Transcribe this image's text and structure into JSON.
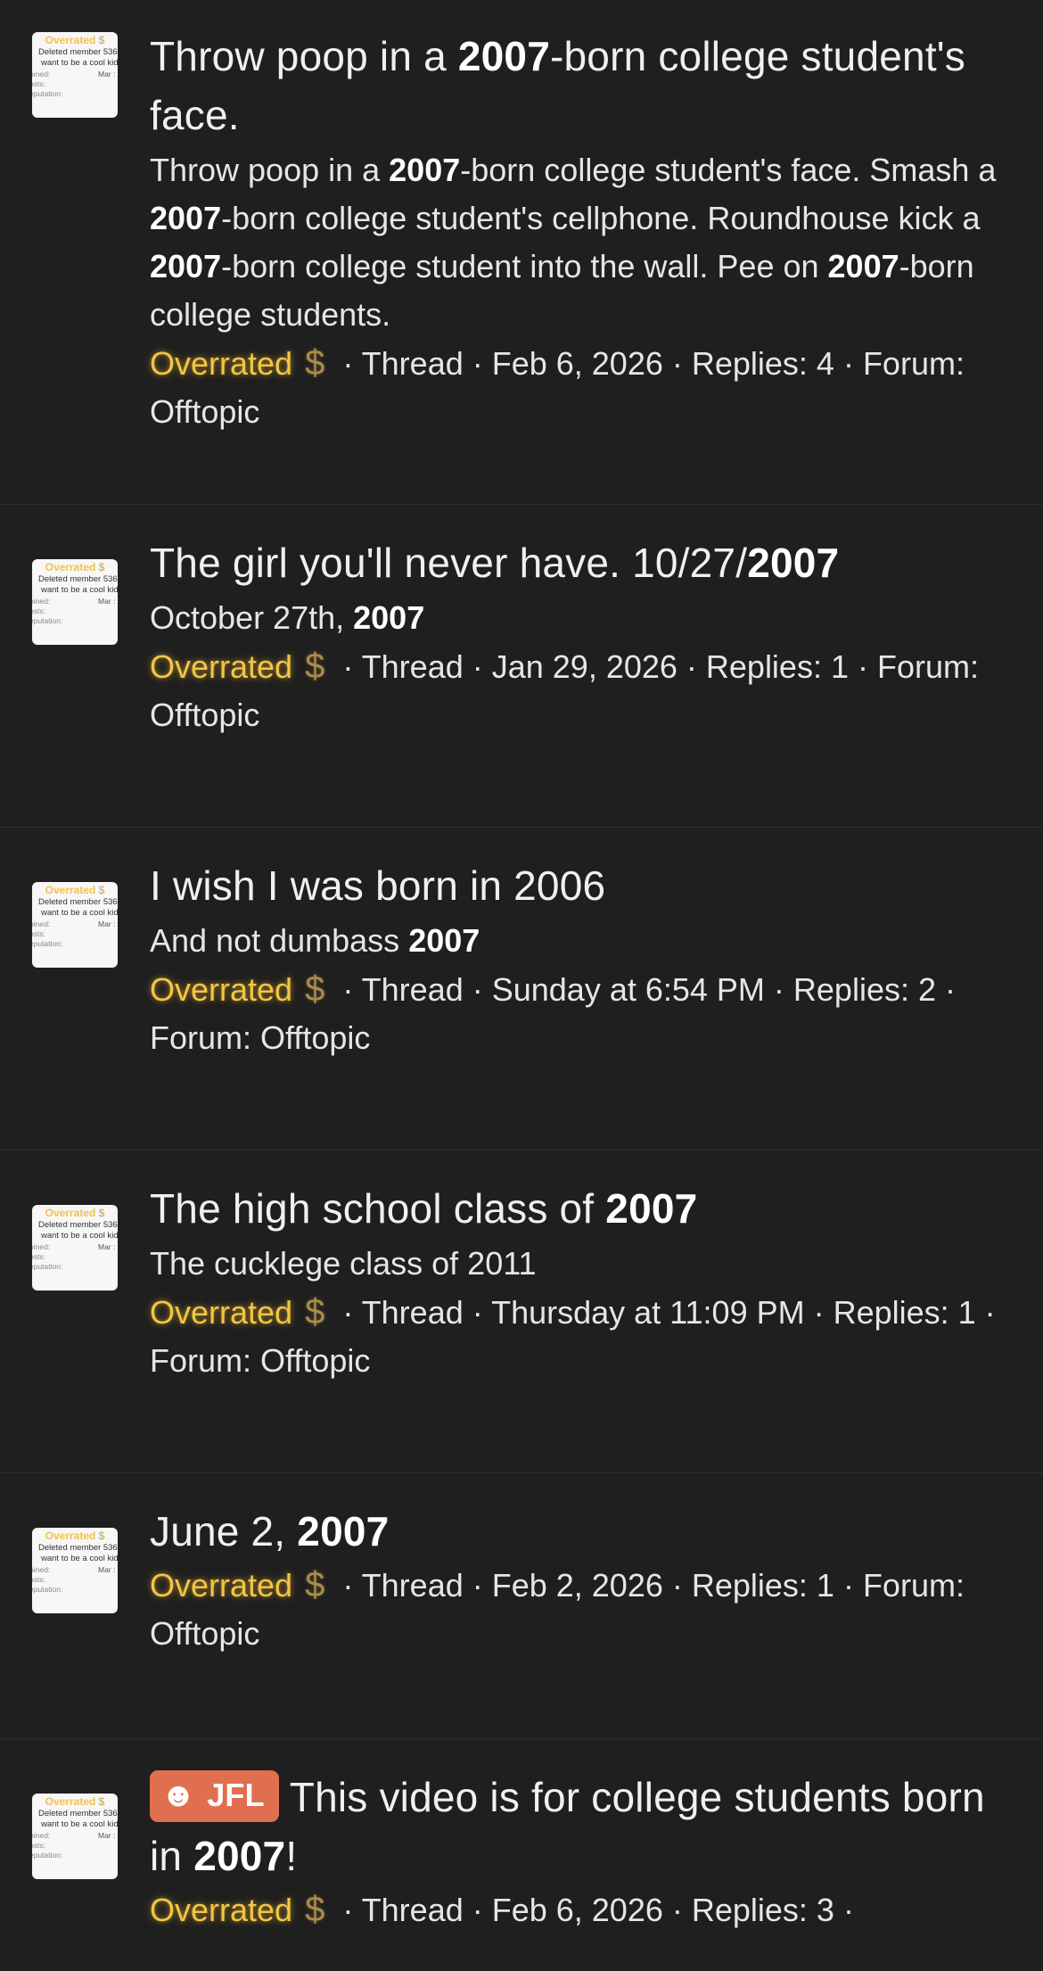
{
  "avatar": {
    "badge_label": "Overrated",
    "badge_icon": "$",
    "line1": "Deleted member 536",
    "line2": "want to be a cool kid",
    "joined_label": "oined:",
    "joined_value": "Mar :",
    "posts_label": "osts:",
    "reputation_label": "eputation:"
  },
  "user_rank": "Overrated",
  "coin_icon": "dollar-coin-icon",
  "results": [
    {
      "title_parts": [
        {
          "text": "Throw poop in a ",
          "bold": false
        },
        {
          "text": "2007",
          "bold": true
        },
        {
          "text": "-born college student's face.",
          "bold": false
        }
      ],
      "snippet_parts": [
        {
          "text": "Throw poop in a ",
          "bold": false
        },
        {
          "text": "2007",
          "bold": true
        },
        {
          "text": "-born college student's face. Smash a ",
          "bold": false
        },
        {
          "text": "2007",
          "bold": true
        },
        {
          "text": "-born college student's cellphone. Roundhouse kick a ",
          "bold": false
        },
        {
          "text": "2007",
          "bold": true
        },
        {
          "text": "-born college student into the wall. Pee on ",
          "bold": false
        },
        {
          "text": "2007",
          "bold": true
        },
        {
          "text": "-born college students.",
          "bold": false
        }
      ],
      "meta": " · Thread · Feb 6, 2026 · Replies: 4 · Forum: Offtopic"
    },
    {
      "title_parts": [
        {
          "text": "The girl you'll never have. 10/27/",
          "bold": false
        },
        {
          "text": "2007",
          "bold": true
        }
      ],
      "snippet_parts": [
        {
          "text": "October 27th, ",
          "bold": false
        },
        {
          "text": "2007",
          "bold": true
        }
      ],
      "meta": " · Thread · Jan 29, 2026 · Replies: 1 · Forum: Offtopic"
    },
    {
      "title_parts": [
        {
          "text": "I wish I was born in 2006",
          "bold": false
        }
      ],
      "snippet_parts": [
        {
          "text": "And not dumbass ",
          "bold": false
        },
        {
          "text": "2007",
          "bold": true
        }
      ],
      "meta": " · Thread · Sunday at 6:54 PM · Replies: 2 · Forum: Offtopic"
    },
    {
      "title_parts": [
        {
          "text": "The high school class of ",
          "bold": false
        },
        {
          "text": "2007",
          "bold": true
        }
      ],
      "snippet_parts": [
        {
          "text": "The cucklege class of 2011",
          "bold": false
        }
      ],
      "meta": " · Thread · Thursday at 11:09 PM · Replies: 1 · Forum: Offtopic"
    },
    {
      "title_parts": [
        {
          "text": "June 2, ",
          "bold": false
        },
        {
          "text": "2007",
          "bold": true
        }
      ],
      "snippet_parts": [],
      "meta": " · Thread · Feb 2, 2026 · Replies: 1 · Forum: Offtopic"
    },
    {
      "prefix": {
        "label": "JFL",
        "icon": "laughing-face-icon",
        "color": "#e06f4f"
      },
      "title_parts": [
        {
          "text": "This video is for college students born in ",
          "bold": false
        },
        {
          "text": "2007",
          "bold": true
        },
        {
          "text": "!",
          "bold": false
        }
      ],
      "snippet_parts": [],
      "meta": " · Thread · Feb 6, 2026 · Replies: 3 ·"
    }
  ]
}
